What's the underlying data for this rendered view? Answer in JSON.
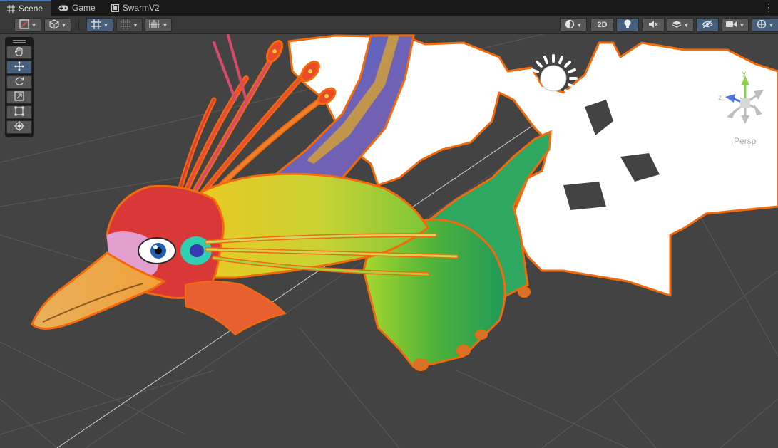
{
  "tabs": [
    {
      "label": "Scene",
      "icon": "grid-icon",
      "active": true
    },
    {
      "label": "Game",
      "icon": "gamepad-icon",
      "active": false
    },
    {
      "label": "SwarmV2",
      "icon": "prefab-scene-icon",
      "active": false
    }
  ],
  "toolbar": {
    "draw_mode_icon": "draw-mode-icon",
    "shading_icon": "shaded-cube-icon",
    "grid_snap_icon": "grid-snap-icon",
    "increment_snap_icon": "increment-snap-icon",
    "ruler_icon": "ruler-icon",
    "view_options": [
      {
        "name": "render-mode-icon"
      },
      {
        "name": "2d-toggle",
        "label": "2D"
      },
      {
        "name": "lighting-toggle-icon"
      },
      {
        "name": "audio-mute-icon"
      },
      {
        "name": "effects-layers-icon"
      },
      {
        "name": "hidden-objects-icon"
      },
      {
        "name": "camera-icon"
      },
      {
        "name": "gizmos-icon"
      }
    ]
  },
  "tool_palette": [
    "hand-tool",
    "move-tool",
    "rotate-tool",
    "scale-tool",
    "rect-tool",
    "transform-tool"
  ],
  "gizmo": {
    "y": "y",
    "z": "z",
    "projection": "Persp"
  },
  "colors": {
    "accent": "#3a79bb",
    "selection_outline": "#f26a0b",
    "toggle_on": "#46607c"
  }
}
